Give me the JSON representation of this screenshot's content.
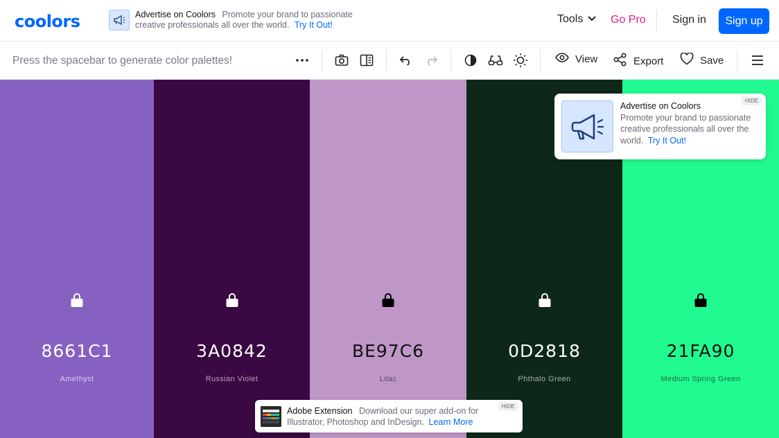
{
  "nav": {
    "logo": "coolors",
    "ad_title": "Advertise on Coolors",
    "ad_body": "Promote your brand to passionate creative professionals all over the world.",
    "ad_link": "Try It Out!",
    "tools": "Tools",
    "gopro": "Go Pro",
    "signin": "Sign in",
    "signup": "Sign up"
  },
  "toolbar": {
    "hint": "Press the spacebar to generate color palettes!",
    "view": "View",
    "export": "Export",
    "save": "Save",
    "icons": [
      "more-options-icon",
      "camera-icon",
      "split-view-icon",
      "undo-icon",
      "redo-icon",
      "contrast-icon",
      "glasses-icon",
      "brightness-icon",
      "eye-icon",
      "share-icon",
      "heart-icon",
      "hamburger-menu-icon"
    ]
  },
  "palette": [
    {
      "hex": "8661C1",
      "name": "Amethyst",
      "bg": "#8661C1",
      "fg": "#ffffff",
      "sub": "#d9cdee",
      "lock": "#ffffff"
    },
    {
      "hex": "3A0842",
      "name": "Russian Violet",
      "bg": "#3A0842",
      "fg": "#ffffff",
      "sub": "#b9a3bd",
      "lock": "#ffffff"
    },
    {
      "hex": "BE97C6",
      "name": "Lilac",
      "bg": "#BE97C6",
      "fg": "#111111",
      "sub": "#5e4a62",
      "lock": "#000000"
    },
    {
      "hex": "0D2818",
      "name": "Phthalo Green",
      "bg": "#0D2818",
      "fg": "#ffffff",
      "sub": "#a6b0aa",
      "lock": "#ffffff"
    },
    {
      "hex": "21FA90",
      "name": "Medium Spring Green",
      "bg": "#21FA90",
      "fg": "#111111",
      "sub": "#196e45",
      "lock": "#000000"
    }
  ],
  "float_ad": {
    "title": "Advertise on Coolors",
    "body": "Promote your brand to passionate creative professionals all over the world.",
    "link": "Try It Out!",
    "hide": "HIDE"
  },
  "bottom_ad": {
    "title": "Adobe Extension",
    "body": "Download our super add-on for Illustrator, Photoshop and InDesign.",
    "link": "Learn More",
    "hide": "HIDE"
  }
}
